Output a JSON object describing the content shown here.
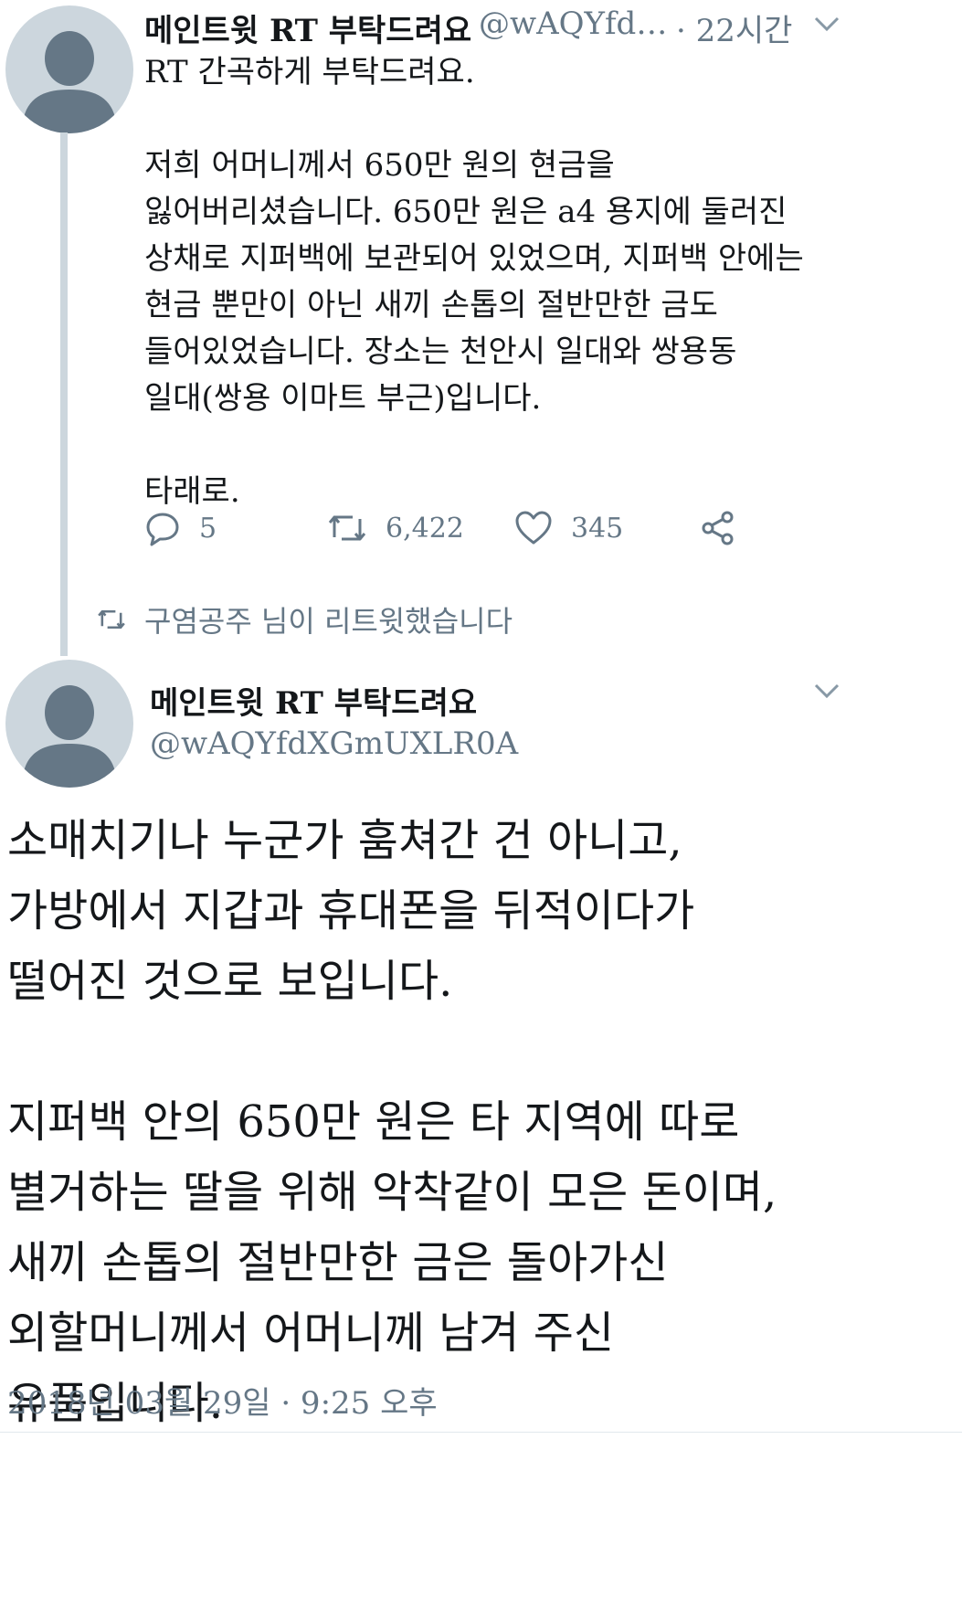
{
  "first_tweet": {
    "author_name": "메인트윗 RT 부탁드려요",
    "author_handle": "@wAQYfd…",
    "time": "· 22시간",
    "text": "RT 간곡하게 부탁드려요.\n\n저희 어머니께서 650만 원의 현금을\n잃어버리셨습니다. 650만 원은 a4 용지에 둘러진\n상채로 지퍼백에 보관되어 있었으며, 지퍼백 안에는\n현금 뿐만이 아닌 새끼 손톱의 절반만한 금도\n들어있었습니다. 장소는 천안시 일대와 쌍용동\n일대(쌍용 이마트 부근)입니다.\n\n타래로.",
    "reply_count": "5",
    "retweet_count": "6,422",
    "like_count": "345",
    "icons": {
      "reply": "reply-icon",
      "retweet": "retweet-icon",
      "like": "heart-icon",
      "share": "share-icon",
      "menu": "chevron-down-icon"
    }
  },
  "retweet_notice": {
    "text": "구염공주 님이 리트윗했습니다"
  },
  "second_tweet": {
    "author_name": "메인트윗 RT 부탁드려요",
    "author_handle": "@wAQYfdXGmUXLR0A",
    "text": "소매치기나 누군가 훔쳐간 건 아니고,\n가방에서 지갑과 휴대폰을 뒤적이다가\n떨어진 것으로 보입니다.\n\n지퍼백 안의 650만 원은 타 지역에 따로\n별거하는 딸을 위해 악착같이 모은 돈이며,\n새끼 손톱의 절반만한 금은 돌아가신\n외할머니께서 어머니께 남겨 주신\n유품입니다.",
    "timestamp": "2018년 03월 29일 · 9:25 오후"
  },
  "colors": {
    "text": "#14171a",
    "muted": "#657786",
    "avatar_bg": "#ccd6dd",
    "avatar_figure": "#657786",
    "thread_line": "#ccd6dd"
  }
}
